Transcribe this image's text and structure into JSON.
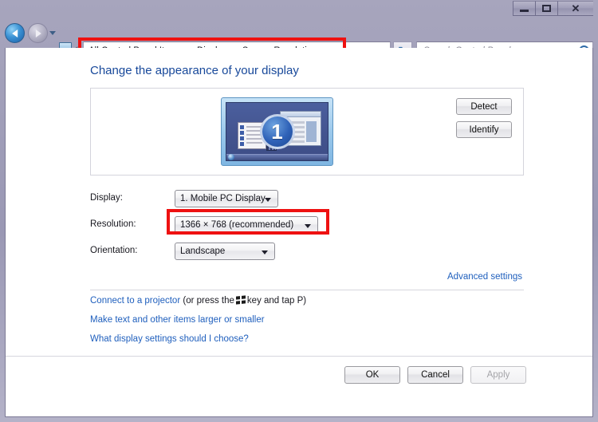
{
  "window": {
    "controls": {
      "minimize": "—",
      "maximize": "❐",
      "close": "✕"
    }
  },
  "navbar": {
    "back_icon": "back-arrow-icon",
    "forward_icon": "forward-arrow-icon",
    "history_icon": "chevron-down-icon",
    "address_icon": "display-icon",
    "address_separator": "◂",
    "breadcrumbs": [
      "All Control Panel Items",
      "Display",
      "Screen Resolution"
    ],
    "dropdown_icon": "chevron-down-icon",
    "refresh_icon": "refresh-icon",
    "refresh_glyph": "↻",
    "search": {
      "placeholder": "Search Control Panel",
      "icon": "search-icon"
    }
  },
  "main": {
    "page_title": "Change the appearance of your display",
    "preview": {
      "monitor_number": "1",
      "detect_label": "Detect",
      "identify_label": "Identify"
    },
    "fields": {
      "display": {
        "label": "Display:",
        "value": "1. Mobile PC Display"
      },
      "resolution": {
        "label": "Resolution:",
        "value": "1366 × 768 (recommended)"
      },
      "orientation": {
        "label": "Orientation:",
        "value": "Landscape"
      }
    },
    "advanced_settings_link": "Advanced settings",
    "links": {
      "projector_lead": "Connect to a projector",
      "projector_mid": "(or press the",
      "projector_tail": "key and tap P)",
      "larger_smaller": "Make text and other items larger or smaller",
      "what_settings": "What display settings should I choose?"
    },
    "buttons": {
      "ok": "OK",
      "cancel": "Cancel",
      "apply": "Apply"
    }
  },
  "highlights": {
    "address_bar": "red-rectangle-annotation",
    "resolution_field": "red-rectangle-annotation"
  },
  "colors": {
    "frame": "#9a98b4",
    "heading_blue": "#17489a",
    "link_blue": "#1f5fbd",
    "highlight_red": "#ee1111"
  }
}
